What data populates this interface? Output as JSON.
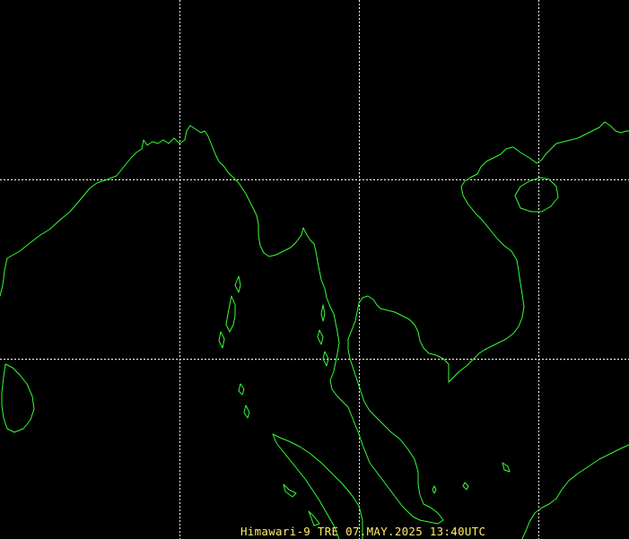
{
  "image": {
    "kind": "satellite coastline map",
    "background_color": "#000000",
    "coastline_color": "#33ff33",
    "graticule_color": "#ffffff",
    "graticule_style": "dotted"
  },
  "caption": {
    "text": "Himawari-9  TRE 07.MAY.2025 13:40UTC",
    "color": "#ffee66"
  }
}
